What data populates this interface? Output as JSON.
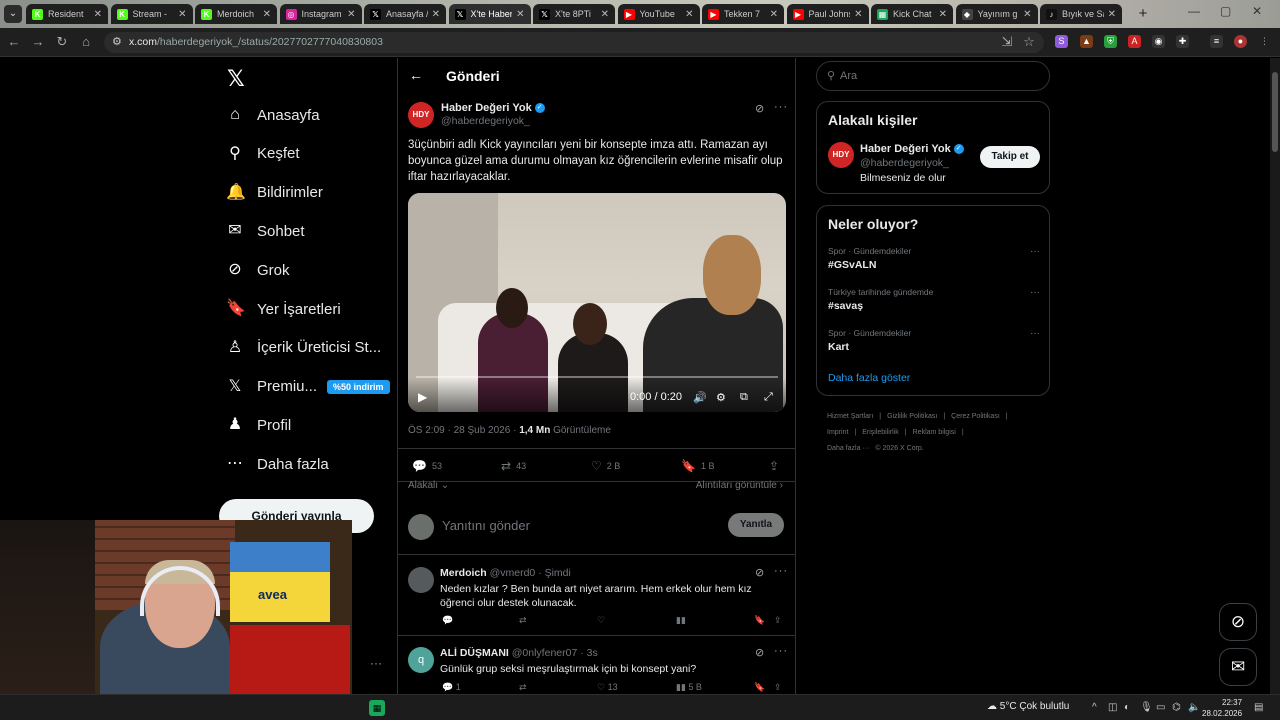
{
  "browser": {
    "tabs": [
      {
        "title": "Resident",
        "icon": "kick-icon",
        "color": "#53fc18",
        "glyph": "K"
      },
      {
        "title": "Stream - ",
        "icon": "kick-icon",
        "color": "#53fc18",
        "glyph": "K"
      },
      {
        "title": "Merdoich",
        "icon": "kick-icon",
        "color": "#53fc18",
        "glyph": "K"
      },
      {
        "title": "Instagram",
        "icon": "instagram-icon",
        "color": "#d6249f",
        "glyph": "◎"
      },
      {
        "title": "Anasayfa /",
        "icon": "x-icon",
        "color": "#000000",
        "glyph": "𝕏"
      },
      {
        "title": "X'te Haber",
        "icon": "x-icon",
        "color": "#000000",
        "glyph": "𝕏"
      },
      {
        "title": "X'te 8PTi",
        "icon": "x-icon",
        "color": "#000000",
        "glyph": "𝕏"
      },
      {
        "title": "YouTube",
        "icon": "youtube-icon",
        "color": "#ff0000",
        "glyph": "▶"
      },
      {
        "title": "Tekken 7",
        "icon": "youtube-icon",
        "color": "#ff0000",
        "glyph": "▶"
      },
      {
        "title": "Paul Johns",
        "icon": "youtube-icon",
        "color": "#ff0000",
        "glyph": "▶"
      },
      {
        "title": "Kick Chat",
        "icon": "kickchat-icon",
        "color": "#1aa95a",
        "glyph": "▦"
      },
      {
        "title": "Yayınım g",
        "icon": "diamond-icon",
        "color": "#444444",
        "glyph": "◆"
      },
      {
        "title": "Bıyık ve Sa",
        "icon": "tiktok-icon",
        "color": "#111111",
        "glyph": "♪"
      }
    ],
    "url_domain": "x.com",
    "url_path": "/haberdegeriyok_/status/2027702777040830803"
  },
  "sidebar": {
    "items": [
      {
        "label": "Anasayfa",
        "icon": "home-icon",
        "glyph": "⌂"
      },
      {
        "label": "Keşfet",
        "icon": "search-icon",
        "glyph": "⚲"
      },
      {
        "label": "Bildirimler",
        "icon": "bell-icon",
        "glyph": "🔔"
      },
      {
        "label": "Sohbet",
        "icon": "mail-icon",
        "glyph": "✉"
      },
      {
        "label": "Grok",
        "icon": "grok-icon",
        "glyph": "⊘"
      },
      {
        "label": "Yer İşaretleri",
        "icon": "bookmark-icon",
        "glyph": "🔖"
      },
      {
        "label": "İçerik Üreticisi St...",
        "icon": "creator-studio-icon",
        "glyph": "♙"
      },
      {
        "label": "Premiu...",
        "icon": "x-premium-icon",
        "glyph": "𝕏",
        "badge": "%50 indirim"
      },
      {
        "label": "Profil",
        "icon": "person-icon",
        "glyph": "♟"
      },
      {
        "label": "Daha fazla",
        "icon": "more-circle-icon",
        "glyph": "⋯"
      }
    ],
    "post_button": "Gönderi yayınla"
  },
  "header": {
    "title": "Gönderi"
  },
  "tweet": {
    "author": "Haber Değeri Yok",
    "handle": "@haberdegeriyok_",
    "avatar_text": "HDY",
    "text": "3üçünbiri adlı Kick yayıncıları yeni bir konsepte imza attı. Ramazan ayı boyunca güzel ama durumu olmayan kız öğrencilerin evlerine misafir olup iftar hazırlayacaklar.",
    "video_time": "0:00 / 0:20",
    "timestamp": "ÖS 2:09 · 28 Şub 2026 · ",
    "views": "1,4 Mn",
    "views_label": " Görüntüleme",
    "replies": "53",
    "reposts": "43",
    "likes": "2 B",
    "bookmarks": "1 B",
    "sort_label": "Alakalı",
    "quotes_label": "Alıntıları görüntüle"
  },
  "reply_box": {
    "placeholder": "Yanıtını gönder",
    "button": "Yanıtla"
  },
  "replies": [
    {
      "name": "Merdoich",
      "handle": "@vmerd0 · Şimdi",
      "text": "Neden kızlar ? Ben bunda art niyet ararım. Hem erkek olur hem kız öğrenci olur destek olunacak.",
      "avatar_color": "#555a5c"
    },
    {
      "name": "ALİ DÜŞMANI",
      "handle": "@0nlyfener07 · 3s",
      "text": "Günlük grup seksi meşrulaştırmak için bi konsept yani?",
      "avatar_color": "#4fa39b",
      "avatar_text": "q",
      "replies": "1",
      "likes": "13",
      "views": "5 B"
    }
  ],
  "right": {
    "search_placeholder": "Ara",
    "related_title": "Alakalı kişiler",
    "related": {
      "name": "Haber Değeri Yok",
      "handle": "@haberdegeriyok_",
      "bio": "Bilmeseniz de olur",
      "follow": "Takip et"
    },
    "trends_title": "Neler oluyor?",
    "trends": [
      {
        "context": "Spor · Gündemdekiler",
        "title": "#GSvALN"
      },
      {
        "context": "Türkiye tarihinde gündemde",
        "title": "#savaş"
      },
      {
        "context": "Spor · Gündemdekiler",
        "title": "Kart"
      }
    ],
    "show_more": "Daha fazla göster",
    "footer": [
      "Hizmet Şartları",
      "|",
      "Gizlilik Politikası",
      "|",
      "Çerez Politikası",
      "|",
      "Imprint",
      "|",
      "Erişilebilirlik",
      "|",
      "Reklam bilgisi",
      "|",
      "Daha fazla ···",
      "© 2026 X Corp."
    ]
  },
  "stream": {
    "banner_text": "avea"
  },
  "taskbar": {
    "weather": "5°C  Çok bulutlu",
    "time": "22:37",
    "date": "28.02.2026"
  }
}
